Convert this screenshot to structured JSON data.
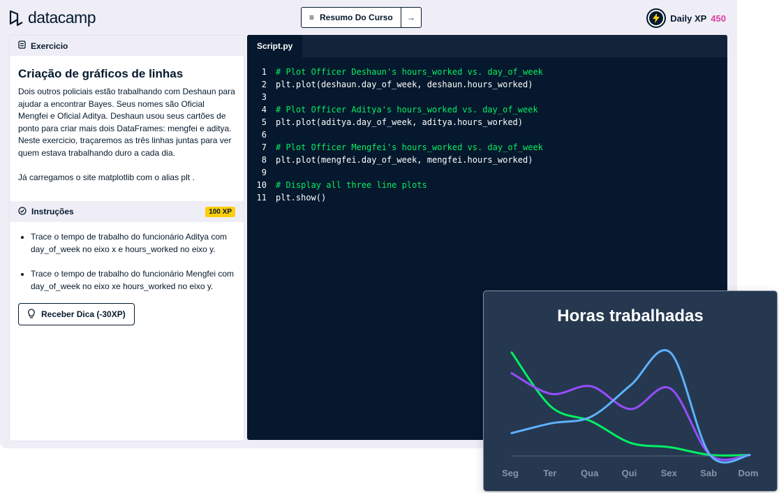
{
  "header": {
    "logo_text": "datacamp",
    "nav_prev_icon": "arrow-left-icon",
    "nav_summary": "Resumo Do Curso",
    "nav_next_icon": "arrow-right-icon",
    "xp_label": "Daily XP",
    "xp_value": "450"
  },
  "exercise": {
    "section_label": "Exercicio",
    "title": "Criação de gráficos de linhas",
    "description": "Dois outros policiais estão trabalhando com Deshaun para ajudar a encontrar Bayes. Seus nomes são Oficial Mengfei e Oficial Aditya. Deshaun usou seus cartões de ponto para criar mais dois DataFrames: mengfei e aditya. Neste exercicio, traçaremos as três linhas juntas para ver quem estava trabalhando duro a cada dia.",
    "note": "Já carregamos o site matplotlib com o alias plt ."
  },
  "instructions": {
    "section_label": "Instruções",
    "xp_chip": "100 XP",
    "items": [
      "Trace o tempo de trabalho do funcionário Aditya com day_of_week no eixo x e hours_worked no eixo y.",
      "Trace o tempo de trabalho do funcionário Mengfei com day_of_week no eixo xe hours_worked no eixo y."
    ],
    "hint_button": "Receber Dica (-30XP)"
  },
  "editor": {
    "tab": "Script.py",
    "lines": [
      {
        "n": "1",
        "text": "# Plot Officer Deshaun's hours_worked vs. day_of_week",
        "kind": "comment"
      },
      {
        "n": "2",
        "text": "plt.plot(deshaun.day_of_week, deshaun.hours_worked)",
        "kind": "plain"
      },
      {
        "n": "3",
        "text": "",
        "kind": "plain"
      },
      {
        "n": "4",
        "text": "# Plot Officer Aditya's hours_worked vs. day_of_week",
        "kind": "comment"
      },
      {
        "n": "5",
        "text": "plt.plot(aditya.day_of_week, aditya.hours_worked)",
        "kind": "plain"
      },
      {
        "n": "6",
        "text": "",
        "kind": "plain"
      },
      {
        "n": "7",
        "text": "# Plot Officer Mengfei's hours_worked vs. day_of_week",
        "kind": "comment"
      },
      {
        "n": "8",
        "text": "plt.plot(mengfei.day_of_week, mengfei.hours_worked)",
        "kind": "plain"
      },
      {
        "n": "9",
        "text": "",
        "kind": "plain"
      },
      {
        "n": "10",
        "text": "# Display all three line plots",
        "kind": "comment"
      },
      {
        "n": "11",
        "text": "plt.show()",
        "kind": "plain"
      }
    ]
  },
  "chart_data": {
    "type": "line",
    "title": "Horas trabalhadas",
    "categories": [
      "Seg",
      "Ter",
      "Qua",
      "Qui",
      "Sex",
      "Sab",
      "Dom"
    ],
    "ylim": [
      0,
      10
    ],
    "grid": false,
    "series": [
      {
        "color": "#03ef62",
        "values": [
          9.5,
          4.5,
          3.2,
          1.2,
          0.8,
          0.1,
          0.1
        ]
      },
      {
        "color": "#974dff",
        "values": [
          7.6,
          5.7,
          6.4,
          4.3,
          6.2,
          0.1,
          0.1
        ]
      },
      {
        "color": "#5eb1ff",
        "values": [
          2.1,
          3.0,
          3.6,
          6.5,
          9.5,
          0.1,
          0.1
        ]
      }
    ]
  },
  "colors": {
    "accent_green": "#03ef62",
    "editor_bg": "#06182d",
    "xp_pink": "#dd3ca0",
    "chip_yellow": "#fcce0d"
  }
}
